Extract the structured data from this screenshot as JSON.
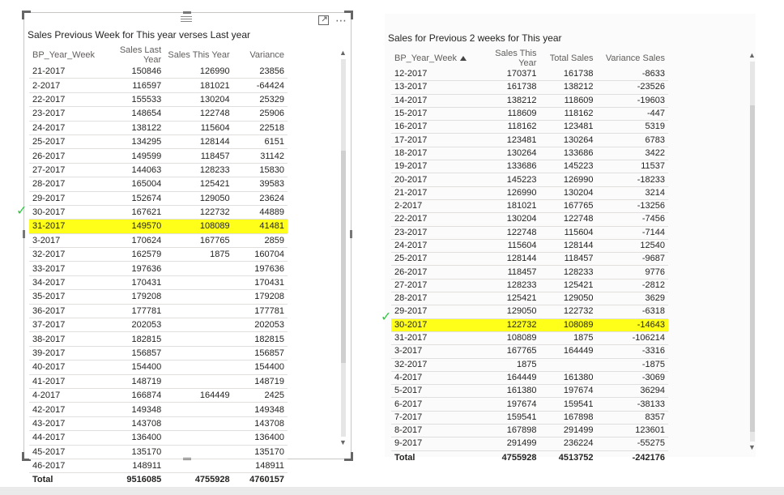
{
  "colors": {
    "highlight": "#ffff1a",
    "check": "#2ecc40"
  },
  "icons": {
    "focus_mode": "focus-mode-icon",
    "more_options": "more-options-icon",
    "grip": "drag-grip-icon"
  },
  "visual1": {
    "title": "Sales Previous Week for This year verses Last year",
    "columns": [
      "BP_Year_Week",
      "Sales Last Year",
      "Sales This Year",
      "Variance"
    ],
    "rows": [
      [
        "21-2017",
        "150846",
        "126990",
        "23856"
      ],
      [
        "2-2017",
        "116597",
        "181021",
        "-64424"
      ],
      [
        "22-2017",
        "155533",
        "130204",
        "25329"
      ],
      [
        "23-2017",
        "148654",
        "122748",
        "25906"
      ],
      [
        "24-2017",
        "138122",
        "115604",
        "22518"
      ],
      [
        "25-2017",
        "134295",
        "128144",
        "6151"
      ],
      [
        "26-2017",
        "149599",
        "118457",
        "31142"
      ],
      [
        "27-2017",
        "144063",
        "128233",
        "15830"
      ],
      [
        "28-2017",
        "165004",
        "125421",
        "39583"
      ],
      [
        "29-2017",
        "152674",
        "129050",
        "23624"
      ],
      [
        "30-2017",
        "167621",
        "122732",
        "44889"
      ],
      [
        "31-2017",
        "149570",
        "108089",
        "41481"
      ],
      [
        "3-2017",
        "170624",
        "167765",
        "2859"
      ],
      [
        "32-2017",
        "162579",
        "1875",
        "160704"
      ],
      [
        "33-2017",
        "197636",
        "",
        "197636"
      ],
      [
        "34-2017",
        "170431",
        "",
        "170431"
      ],
      [
        "35-2017",
        "179208",
        "",
        "179208"
      ],
      [
        "36-2017",
        "177781",
        "",
        "177781"
      ],
      [
        "37-2017",
        "202053",
        "",
        "202053"
      ],
      [
        "38-2017",
        "182815",
        "",
        "182815"
      ],
      [
        "39-2017",
        "156857",
        "",
        "156857"
      ],
      [
        "40-2017",
        "154400",
        "",
        "154400"
      ],
      [
        "41-2017",
        "148719",
        "",
        "148719"
      ],
      [
        "4-2017",
        "166874",
        "164449",
        "2425"
      ],
      [
        "42-2017",
        "149348",
        "",
        "149348"
      ],
      [
        "43-2017",
        "143708",
        "",
        "143708"
      ],
      [
        "44-2017",
        "136400",
        "",
        "136400"
      ],
      [
        "45-2017",
        "135170",
        "",
        "135170"
      ],
      [
        "46-2017",
        "148911",
        "",
        "148911"
      ]
    ],
    "highlight_row": 11,
    "total": [
      "Total",
      "9516085",
      "4755928",
      "4760157"
    ],
    "check_mark": "✓"
  },
  "visual2": {
    "title": "Sales for Previous 2 weeks for This year",
    "columns": [
      "BP_Year_Week",
      "Sales This Year",
      "Total Sales",
      "Variance Sales"
    ],
    "sorted_column": 0,
    "rows": [
      [
        "12-2017",
        "170371",
        "161738",
        "-8633"
      ],
      [
        "13-2017",
        "161738",
        "138212",
        "-23526"
      ],
      [
        "14-2017",
        "138212",
        "118609",
        "-19603"
      ],
      [
        "15-2017",
        "118609",
        "118162",
        "-447"
      ],
      [
        "16-2017",
        "118162",
        "123481",
        "5319"
      ],
      [
        "17-2017",
        "123481",
        "130264",
        "6783"
      ],
      [
        "18-2017",
        "130264",
        "133686",
        "3422"
      ],
      [
        "19-2017",
        "133686",
        "145223",
        "11537"
      ],
      [
        "20-2017",
        "145223",
        "126990",
        "-18233"
      ],
      [
        "21-2017",
        "126990",
        "130204",
        "3214"
      ],
      [
        "2-2017",
        "181021",
        "167765",
        "-13256"
      ],
      [
        "22-2017",
        "130204",
        "122748",
        "-7456"
      ],
      [
        "23-2017",
        "122748",
        "115604",
        "-7144"
      ],
      [
        "24-2017",
        "115604",
        "128144",
        "12540"
      ],
      [
        "25-2017",
        "128144",
        "118457",
        "-9687"
      ],
      [
        "26-2017",
        "118457",
        "128233",
        "9776"
      ],
      [
        "27-2017",
        "128233",
        "125421",
        "-2812"
      ],
      [
        "28-2017",
        "125421",
        "129050",
        "3629"
      ],
      [
        "29-2017",
        "129050",
        "122732",
        "-6318"
      ],
      [
        "30-2017",
        "122732",
        "108089",
        "-14643"
      ],
      [
        "31-2017",
        "108089",
        "1875",
        "-106214"
      ],
      [
        "3-2017",
        "167765",
        "164449",
        "-3316"
      ],
      [
        "32-2017",
        "1875",
        "",
        "-1875"
      ],
      [
        "4-2017",
        "164449",
        "161380",
        "-3069"
      ],
      [
        "5-2017",
        "161380",
        "197674",
        "36294"
      ],
      [
        "6-2017",
        "197674",
        "159541",
        "-38133"
      ],
      [
        "7-2017",
        "159541",
        "167898",
        "8357"
      ],
      [
        "8-2017",
        "167898",
        "291499",
        "123601"
      ],
      [
        "9-2017",
        "291499",
        "236224",
        "-55275"
      ]
    ],
    "highlight_row": 19,
    "total": [
      "Total",
      "4755928",
      "4513752",
      "-242176"
    ],
    "check_mark": "✓"
  }
}
